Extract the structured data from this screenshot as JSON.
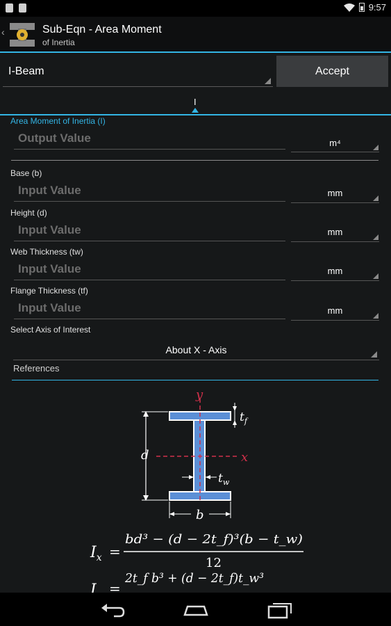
{
  "status": {
    "time": "9:57"
  },
  "actionbar": {
    "title": "Sub-Eqn - Area Moment",
    "subtitle": "of Inertia"
  },
  "shape_spinner": {
    "selected": "I-Beam"
  },
  "accept_label": "Accept",
  "tab": {
    "label": "I"
  },
  "fields": [
    {
      "label": "Area Moment of Inertia (I)",
      "placeholder": "Output Value",
      "unit": "m⁴"
    },
    {
      "label": "Base (b)",
      "placeholder": "Input Value",
      "unit": "mm"
    },
    {
      "label": "Height (d)",
      "placeholder": "Input Value",
      "unit": "mm"
    },
    {
      "label": "Web Thickness (tw)",
      "placeholder": "Input Value",
      "unit": "mm"
    },
    {
      "label": "Flange Thickness (tf)",
      "placeholder": "Input Value",
      "unit": "mm"
    }
  ],
  "axis": {
    "label": "Select Axis of Interest",
    "selected": "About X - Axis"
  },
  "references_label": "References",
  "diagram": {
    "axis_y": "y",
    "axis_x": "x",
    "dim_d": "d",
    "dim_b": "b",
    "dim_tf": "t",
    "dim_tf_sub": "f",
    "dim_tw": "t",
    "dim_tw_sub": "w",
    "eq1_lhs": "I",
    "eq1_lhs_sub": "x",
    "eq1_num": "bd³ − (d − 2t_f)³(b − t_w)",
    "eq1_den": "12",
    "eq2_lhs": "I",
    "eq2_num": "2t_f b³ + (d − 2t_f)t_w³"
  },
  "colors": {
    "accent": "#33b5e5",
    "beam": "#5b8fd6",
    "axis": "#d0304a"
  }
}
